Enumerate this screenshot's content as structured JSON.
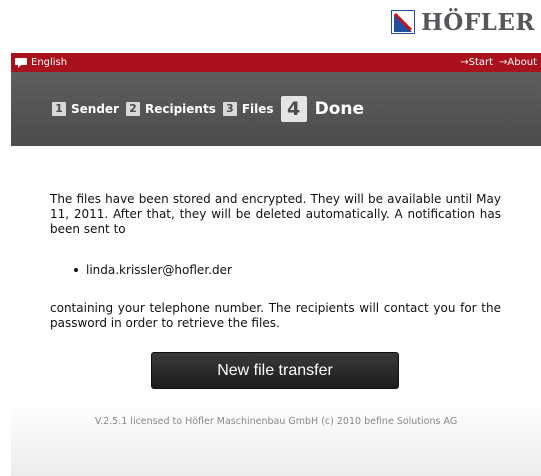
{
  "brand": {
    "name": "HÖFLER"
  },
  "topbar": {
    "language": "English",
    "links": [
      "→Start",
      "→About"
    ]
  },
  "steps": [
    {
      "number": "1",
      "label": "Sender",
      "active": false
    },
    {
      "number": "2",
      "label": "Recipients",
      "active": false
    },
    {
      "number": "3",
      "label": "Files",
      "active": false
    },
    {
      "number": "4",
      "label": "Done",
      "active": true
    }
  ],
  "main": {
    "message1": "The files have been stored and encrypted. They will be available until May 11, 2011. After that, they will be deleted automatically. A notification has been sent to",
    "recipient": "linda.krissler@hofler.der",
    "message2": "containing your telephone number. The recipients will contact you for the password in order to retrieve the files.",
    "button_label": "New file transfer"
  },
  "footer": {
    "version_text": "V.2.5.1 licensed to Höfler Maschinenbau GmbH (c) 2010 befine Solutions AG"
  },
  "colors": {
    "accent": "#a9121d",
    "header_bg": "#555555",
    "button_bg": "#2a2a2a"
  }
}
